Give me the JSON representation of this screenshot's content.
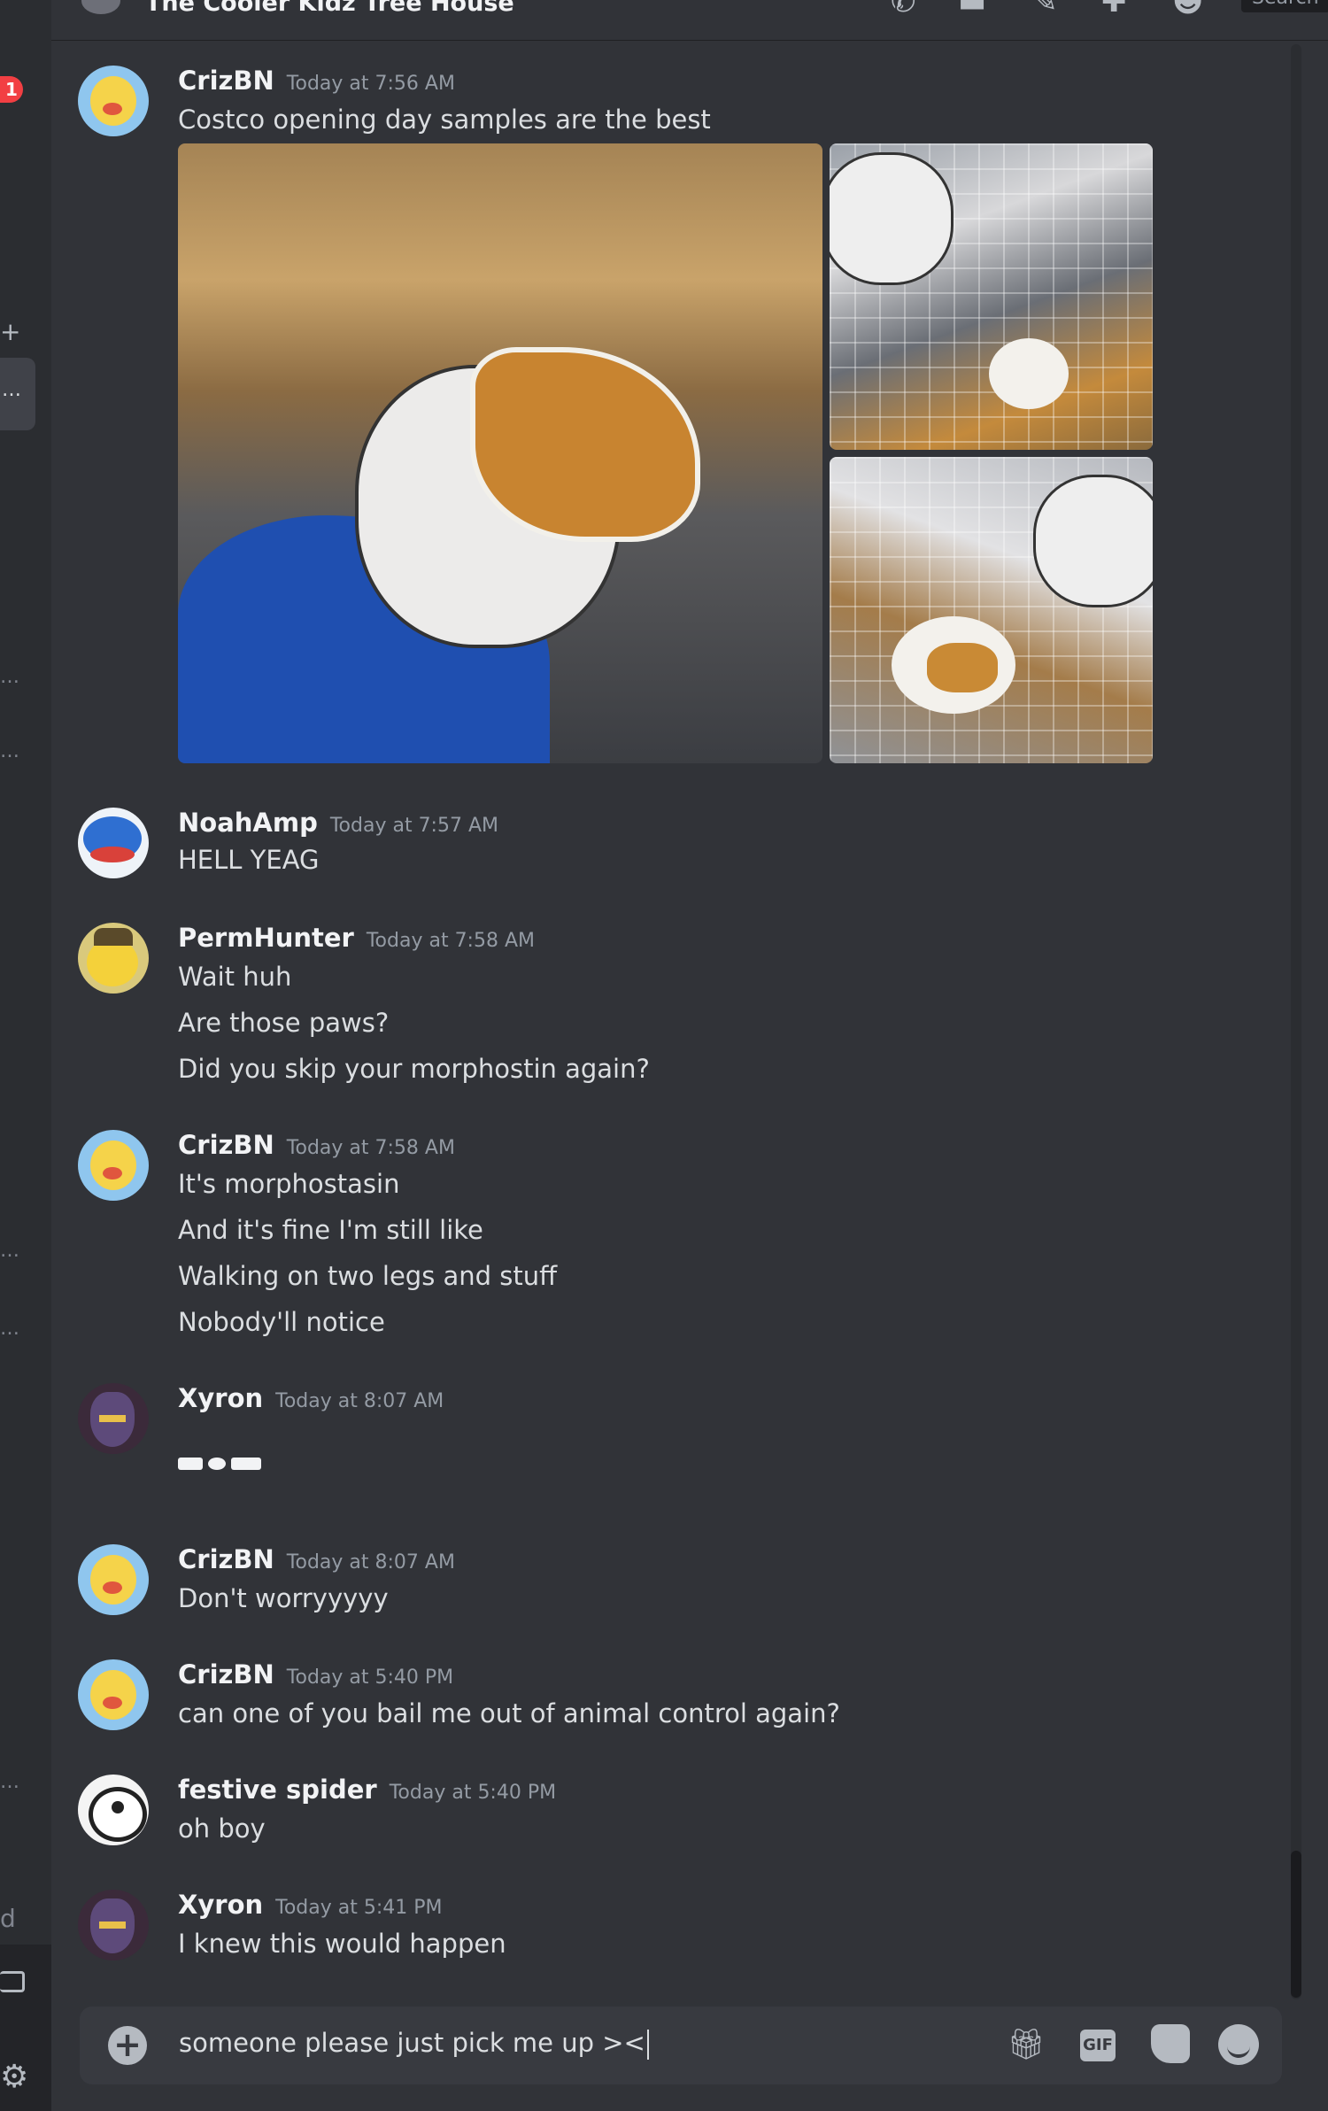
{
  "header": {
    "channel_title": "The Cooler Kidz Tree House",
    "search_placeholder": "Search"
  },
  "rail": {
    "mention_badge": "1",
    "add_label": "+",
    "partial_label": "d"
  },
  "messages": [
    {
      "author": "CrizBN",
      "timestamp": "Today at 7:56 AM",
      "lines": [
        "Costco opening day samples are the best"
      ]
    },
    {
      "author": "NoahAmp",
      "timestamp": "Today at 7:57 AM",
      "lines": [
        "HELL YEAG"
      ]
    },
    {
      "author": "PermHunter",
      "timestamp": "Today at 7:58 AM",
      "lines": [
        "Wait huh",
        "Are those paws?",
        "Did you skip your morphostin again?"
      ]
    },
    {
      "author": "CrizBN",
      "timestamp": "Today at 7:58 AM",
      "lines": [
        "It's morphostasin",
        "And it's fine I'm still like",
        "Walking on two legs and stuff",
        "Nobody'll notice"
      ]
    },
    {
      "author": "Xyron",
      "timestamp": "Today at 8:07 AM",
      "lines": []
    },
    {
      "author": "CrizBN",
      "timestamp": "Today at 8:07 AM",
      "lines": [
        "Don't worryyyyy"
      ]
    },
    {
      "author": "CrizBN",
      "timestamp": "Today at 5:40 PM",
      "lines": [
        "can one of you bail me out of animal control again?"
      ]
    },
    {
      "author": "festive spider",
      "timestamp": "Today at 5:40 PM",
      "lines": [
        "oh boy"
      ]
    },
    {
      "author": "Xyron",
      "timestamp": "Today at 5:41 PM",
      "lines": [
        "I knew this would happen"
      ]
    }
  ],
  "composer": {
    "value": "someone please just pick me up ><",
    "gif_label": "GIF"
  },
  "icons": {
    "call": "phone-icon",
    "video": "video-icon",
    "pin": "pin-icon",
    "add_member": "add-member-icon",
    "members": "members-icon",
    "gift": "gift-icon",
    "sticker": "sticker-icon",
    "emoji": "emoji-icon",
    "settings": "gear-icon"
  }
}
